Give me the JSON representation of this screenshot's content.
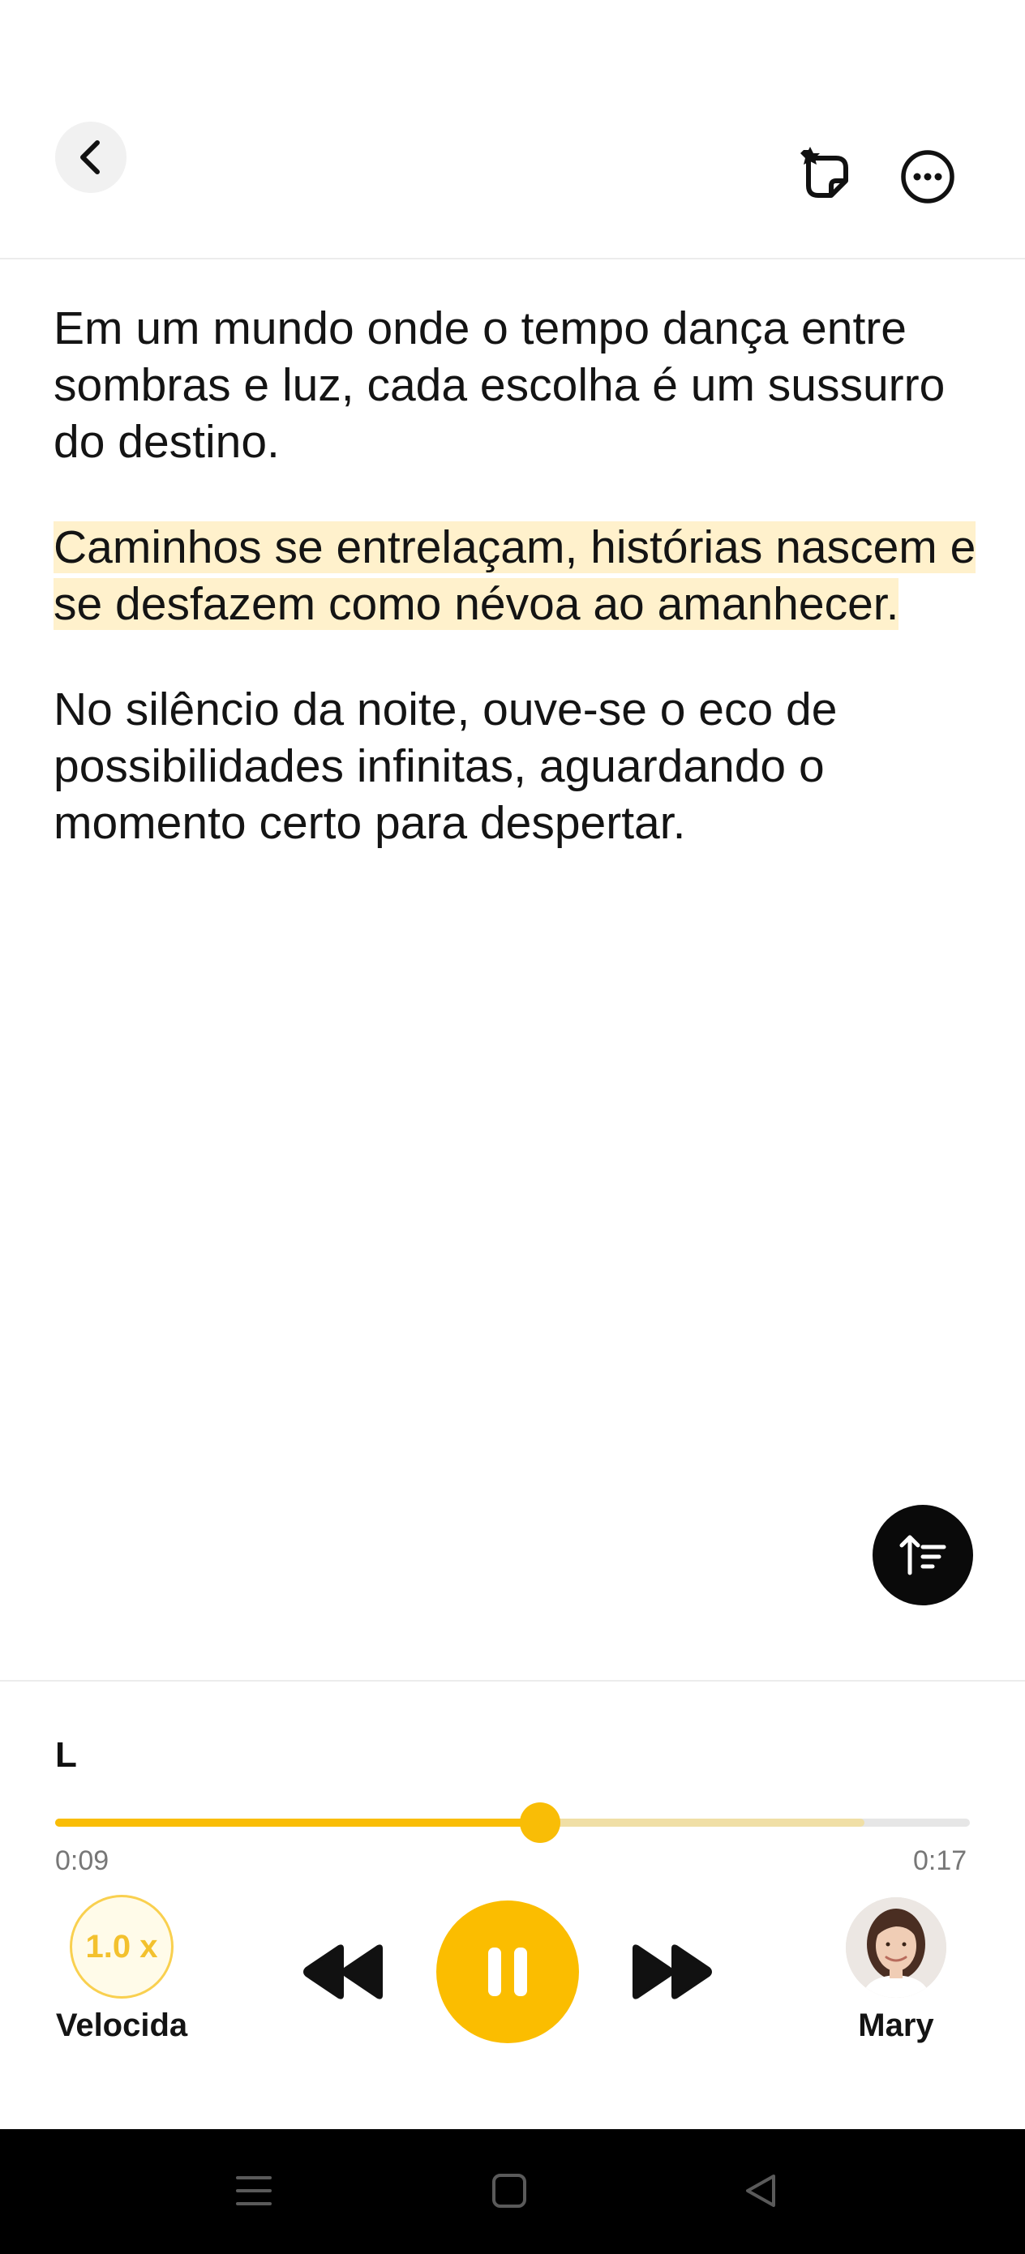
{
  "header": {
    "back_icon": "chevron-left-icon",
    "sticker_icon": "sticker-add-icon",
    "more_icon": "more-horizontal-icon"
  },
  "paragraphs": [
    "Em um mundo onde o tempo dança entre sombras e luz, cada escolha é um sussurro do destino.",
    "Caminhos se entrelaçam, histórias nascem e se desfazem como névoa ao amanhecer.",
    "No silêncio da noite, ouve-se o eco de possibilidades infinitas, aguardando o momento certo para despertar."
  ],
  "highlighted_paragraph_index": 1,
  "sort_fab_icon": "sort-ascending-icon",
  "player": {
    "title": "L",
    "current_time": "0:09",
    "total_time": "0:17",
    "progress_fraction": 0.53,
    "buffered_fraction": 0.885,
    "speed_value": "1.0 x",
    "speed_label": "Velocida",
    "voice_name": "Mary",
    "rewind_icon": "rewind-icon",
    "pause_icon": "pause-icon",
    "forward_icon": "fast-forward-icon"
  },
  "colors": {
    "accent": "#fbbd00",
    "highlight": "#fff1cc",
    "speed_border": "#f9d04f"
  },
  "system_nav": {
    "menu_icon": "menu-icon",
    "home_icon": "home-square-icon",
    "back_icon": "back-triangle-icon"
  }
}
